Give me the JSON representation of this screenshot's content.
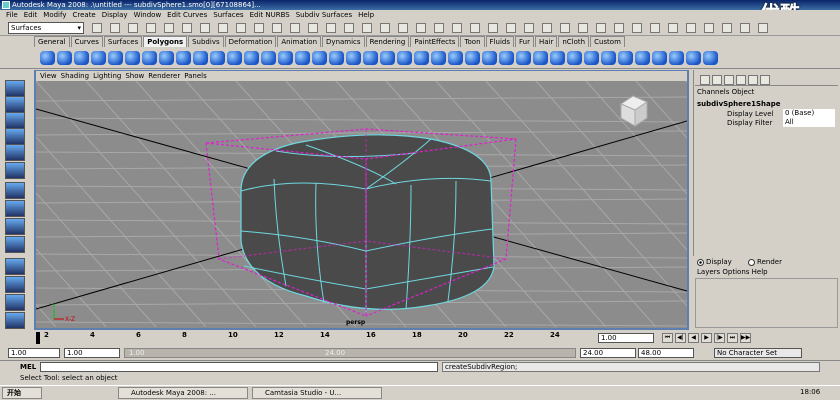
{
  "titlebar": {
    "title": "Autodesk Maya 2008: .\\untitled   ---   subdivSphere1.smo[0][67108864]..."
  },
  "watermark": "优酷",
  "menubar": [
    "File",
    "Edit",
    "Modify",
    "Create",
    "Display",
    "Window",
    "Edit Curves",
    "Surfaces",
    "Edit NURBS",
    "Subdiv Surfaces",
    "Help"
  ],
  "menuset": "Surfaces",
  "shelf_tabs": [
    "General",
    "Curves",
    "Surfaces",
    "Polygons",
    "Subdivs",
    "Deformation",
    "Animation",
    "Dynamics",
    "Rendering",
    "PaintEffects",
    "Toon",
    "Fluids",
    "Fur",
    "Hair",
    "nCloth",
    "Custom"
  ],
  "active_shelf_tab": "Polygons",
  "viewport": {
    "menu": [
      "View",
      "Shading",
      "Lighting",
      "Show",
      "Renderer",
      "Panels"
    ],
    "camera_label": "persp",
    "axis_labels": [
      "Y",
      "X",
      "Z"
    ]
  },
  "channel_box": {
    "header": [
      "Channels",
      "Object"
    ],
    "node_name": "subdivSphere1Shape",
    "rows": [
      {
        "label": "Display Level",
        "value": "0 (Base)"
      },
      {
        "label": "Display Filter",
        "value": "All"
      }
    ],
    "radio_display": "Display",
    "radio_render": "Render",
    "layers_menu": [
      "Layers",
      "Options",
      "Help"
    ]
  },
  "timeline": {
    "ticks": [
      "2",
      "4",
      "6",
      "8",
      "10",
      "12",
      "14",
      "16",
      "18",
      "20",
      "22",
      "24"
    ],
    "current_frame": "1.00"
  },
  "range": {
    "start": "1.00",
    "playback_start": "1.00",
    "slider_start": "1.00",
    "slider_end": "24.00",
    "playback_end": "24.00",
    "end": "48.00",
    "character_set": "No Character Set"
  },
  "command": {
    "label": "MEL",
    "history": "createSubdivRegion;"
  },
  "help_line": "Select Tool: select an object",
  "taskbar": {
    "start": "开始",
    "buttons": [
      "Autodesk Maya 2008: ...",
      "Camtasia Studio - U..."
    ],
    "clock": "18:06"
  },
  "colors": {
    "viewport_bg": "#8c8c8c",
    "wire": "#6fd8e0",
    "bbox": "#e020d0",
    "title_blue": "#0a246a"
  }
}
